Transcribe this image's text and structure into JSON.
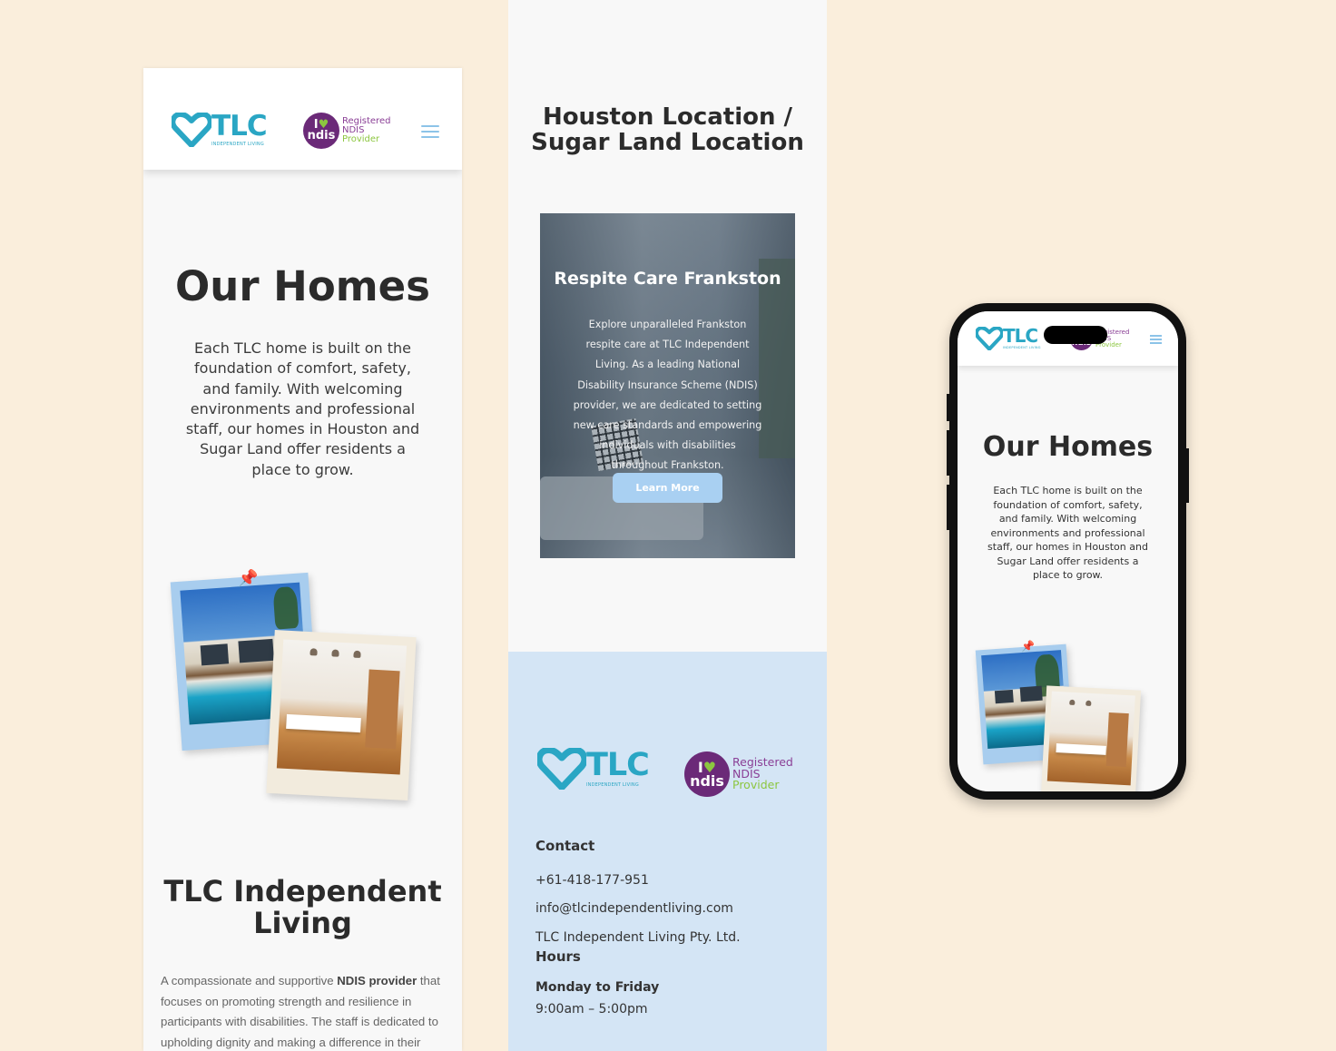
{
  "brand": {
    "tlc_wordmark": "TLC",
    "tlc_tagline": "INDEPENDENT LIVING",
    "ndis_i": "I",
    "ndis_word": "ndis",
    "ndis_line1": "Registered",
    "ndis_line2": "NDIS",
    "ndis_line3": "Provider",
    "colors": {
      "teal": "#2aa6c4",
      "purple": "#6b2a78",
      "green": "#8cc63f",
      "background": "#faeedc",
      "footer": "#d4e5f5",
      "button": "#a9d0f2"
    }
  },
  "homes_page": {
    "title": "Our Homes",
    "intro": "Each TLC home is built on the foundation of comfort, safety, and family. With welcoming environments and professional staff, our homes in Houston and Sugar Land  offer residents a place to grow.",
    "about_title": "TLC Independent Living",
    "about_text_before": "A compassionate and supportive ",
    "about_text_bold": "NDIS provider",
    "about_text_after": " that focuses on promoting strength and resilience in participants with disabilities. The staff is dedicated to upholding dignity and making a difference in their"
  },
  "location_page": {
    "title": "Houston Location / Sugar Land Location",
    "card": {
      "title": "Respite Care Frankston",
      "text": "Explore unparalleled Frankston respite care at TLC Independent Living. As a leading National Disability Insurance Scheme (NDIS) provider, we are dedicated to setting new care standards and empowering individuals with disabilities throughout Frankston.",
      "button": "Learn More"
    }
  },
  "footer": {
    "contact_heading": "Contact",
    "phone": "+61-418-177-951",
    "email": "info@tlcindependentliving.com",
    "company": "TLC Independent Living Pty. Ltd.",
    "hours_heading": "Hours",
    "days": "Monday to Friday",
    "time": "9:00am – 5:00pm"
  },
  "icons": [
    "heart-logo-icon",
    "hamburger-menu-icon",
    "pushpin-icon",
    "mini-heart-icon"
  ]
}
